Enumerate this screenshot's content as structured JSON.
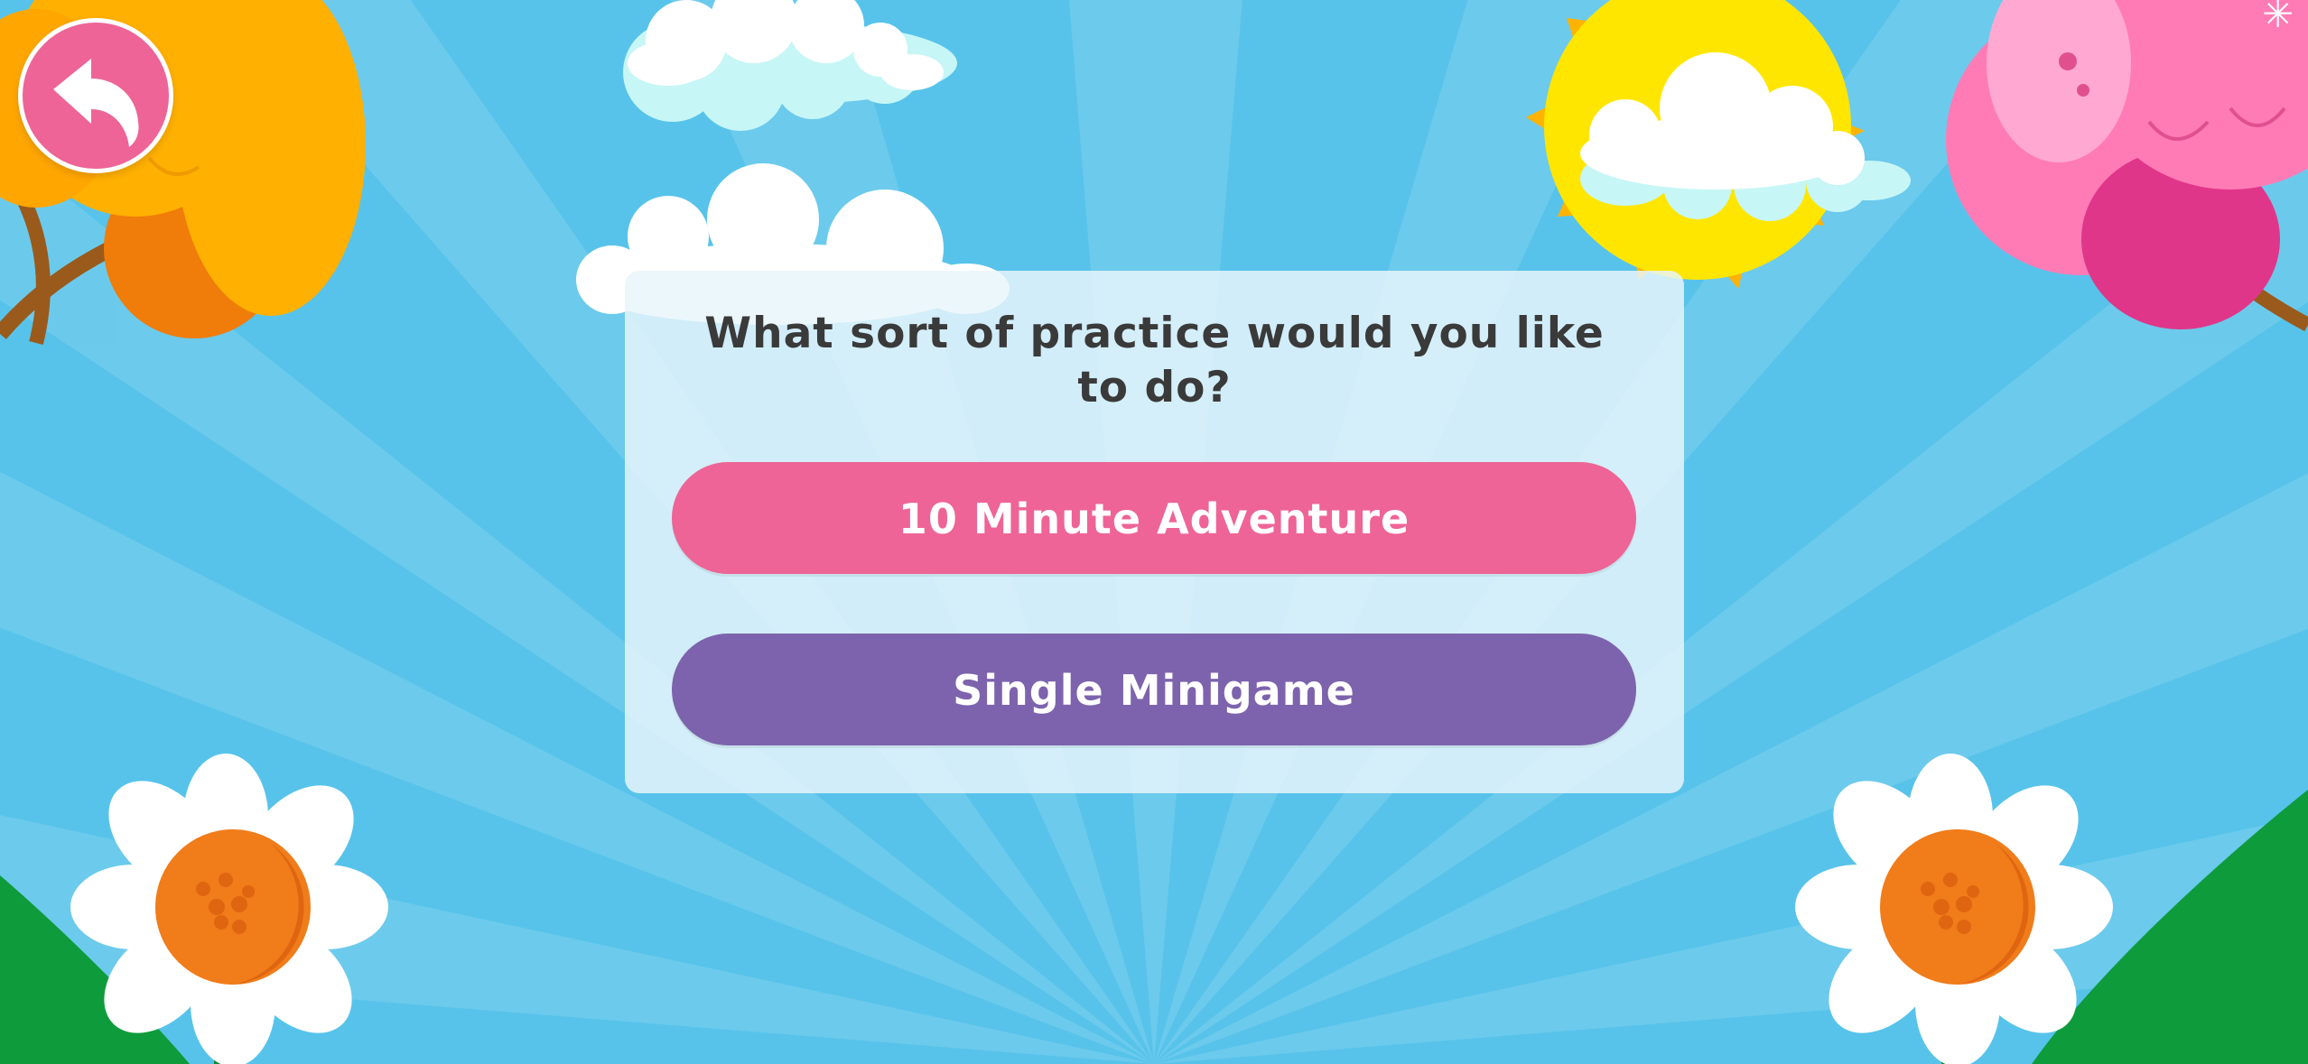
{
  "game": {
    "prompt": "What sort of practice would you like to do?",
    "options": [
      {
        "label": "10 Minute Adventure",
        "color": "#ee6496"
      },
      {
        "label": "Single Minigame",
        "color": "#7d63ad"
      }
    ]
  },
  "navigation": {
    "back_icon": "back-arrow-icon",
    "back_color": "#ee6496"
  },
  "theme": {
    "sky": "#57c3ea",
    "dialog": "#e8f6fb",
    "text": "#3a3a3a"
  }
}
